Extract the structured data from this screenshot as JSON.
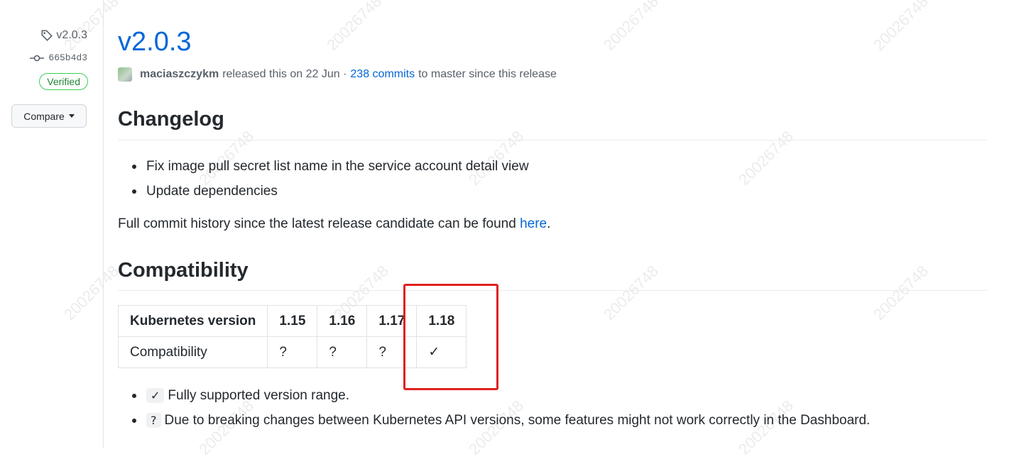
{
  "sidebar": {
    "tag": "v2.0.3",
    "commit": "665b4d3",
    "verified": "Verified",
    "compare": "Compare"
  },
  "release": {
    "title": "v2.0.3",
    "author": "maciaszczykm",
    "released_text": "released this on 22 Jun ·",
    "commits_link": "238 commits",
    "since_text": "to master since this release"
  },
  "changelog": {
    "heading": "Changelog",
    "items": [
      "Fix image pull secret list name in the service account detail view",
      "Update dependencies"
    ],
    "history_text": "Full commit history since the latest release candidate can be found ",
    "history_link": "here",
    "history_end": "."
  },
  "compatibility": {
    "heading": "Compatibility",
    "header": [
      "Kubernetes version",
      "1.15",
      "1.16",
      "1.17",
      "1.18"
    ],
    "row": [
      "Compatibility",
      "?",
      "?",
      "?",
      "✓"
    ],
    "legend": [
      {
        "symbol": "✓",
        "text": "Fully supported version range."
      },
      {
        "symbol": "?",
        "text": "Due to breaking changes between Kubernetes API versions, some features might not work correctly in the Dashboard."
      }
    ]
  },
  "watermark": "20026748",
  "colors": {
    "link": "#0366d6",
    "highlight": "#e02020",
    "verified": "#22863a"
  }
}
